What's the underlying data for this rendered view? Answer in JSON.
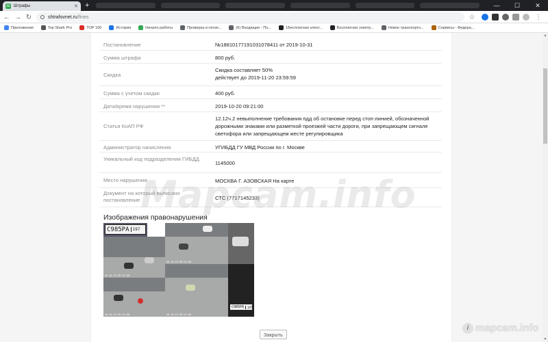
{
  "browser": {
    "tab_title": "Штрафы",
    "url_host": "shtrafovnet.ru",
    "url_path": "/fines",
    "bookmarks": [
      {
        "label": "Приложения",
        "color": "#4285f4"
      },
      {
        "label": "Top Shark Pro",
        "color": "#555555"
      },
      {
        "label": "TOP 100",
        "color": "#d93025"
      },
      {
        "label": "История",
        "color": "#1a73e8"
      },
      {
        "label": "Начало работы",
        "color": "#34a853"
      },
      {
        "label": "Проверка и оплат...",
        "color": "#5f6368"
      },
      {
        "label": "(6) Входящие - По...",
        "color": "#5f6368"
      },
      {
        "label": "1Бесплатная элект...",
        "color": "#202124"
      },
      {
        "label": "Бесплатная электр...",
        "color": "#202124"
      },
      {
        "label": "Новое транспортн...",
        "color": "#5f6368"
      },
      {
        "label": "Сервисы - Федера...",
        "color": "#b06000"
      }
    ]
  },
  "fine": {
    "rows": [
      {
        "label": "Постановление",
        "value": "№18810177191031078411 от 2019-10-31"
      },
      {
        "label": "Сумма штрафа",
        "value": "800 руб."
      },
      {
        "label": "Скидка",
        "value": "Скидка составляет 50%",
        "value2": "действует до 2019-11-20 23:59:59"
      },
      {
        "label": "Сумма с учетом скидки",
        "value": "400 руб."
      },
      {
        "label": "Дата/время нарушения **",
        "value": "2019-10-20 09:21:00"
      },
      {
        "label": "Статья КоАП РФ",
        "value": "12.12ч.2 невыполнение требования пдд об остановке перед стоп-линией, обозначенной дорожными знаками или разметкой проезжей части дороги, при запрещающем сигнале светофора или запрещающем жесте регулировщика"
      },
      {
        "label": "Администратор начисления",
        "value": "УГИБДД ГУ МВД России по г. Москве"
      },
      {
        "label": "Уникальный код подразделения ГИБДД",
        "value": "1145000"
      },
      {
        "label": "Место нарушения",
        "value": "МОСКВА Г. АЗОВСКАЯ На карте"
      },
      {
        "label": "Документ на который выписано постановление",
        "value": "СТС (7717145233)"
      }
    ],
    "images_title": "Изображения правонарушения",
    "plate_number": "С985РА",
    "plate_region": "197",
    "close_label": "Закрыть"
  },
  "watermark": {
    "center_text": "Mapcam.info",
    "logo_text": "mapcam.info",
    "logo_letter": "i"
  }
}
